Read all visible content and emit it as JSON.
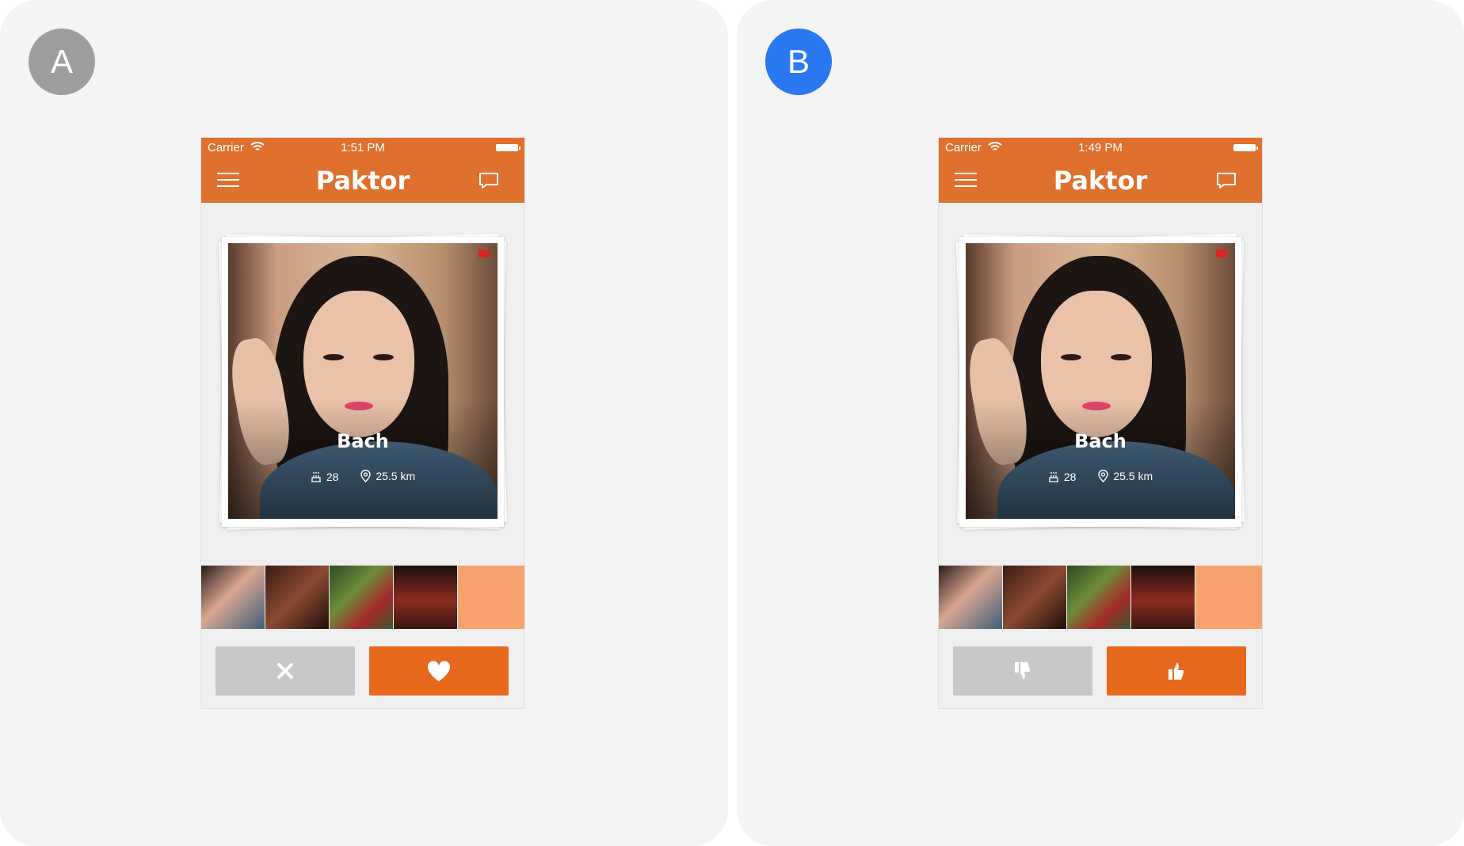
{
  "panels": [
    {
      "badge": "A",
      "status": {
        "carrier": "Carrier",
        "time": "1:51 PM"
      },
      "app_title": "Paktor",
      "profile": {
        "name": "Bach",
        "age": "28",
        "distance": "25.5 km"
      },
      "thumbnails": [
        "photo-1",
        "photo-2",
        "photo-3",
        "photo-4"
      ],
      "dislike_icon": "close-icon",
      "like_icon": "heart-icon"
    },
    {
      "badge": "B",
      "status": {
        "carrier": "Carrier",
        "time": "1:49 PM"
      },
      "app_title": "Paktor",
      "profile": {
        "name": "Bach",
        "age": "28",
        "distance": "25.5 km"
      },
      "thumbnails": [
        "photo-1",
        "photo-2",
        "photo-3",
        "photo-4"
      ],
      "dislike_icon": "thumbs-down-icon",
      "like_icon": "thumbs-up-icon"
    }
  ],
  "colors": {
    "brand": "#e0702e",
    "like": "#e8691d",
    "dislike": "#c8c8c8",
    "empty_slot": "#f5a26f",
    "badge_a": "#9e9e9e",
    "badge_b": "#2a78f2"
  }
}
